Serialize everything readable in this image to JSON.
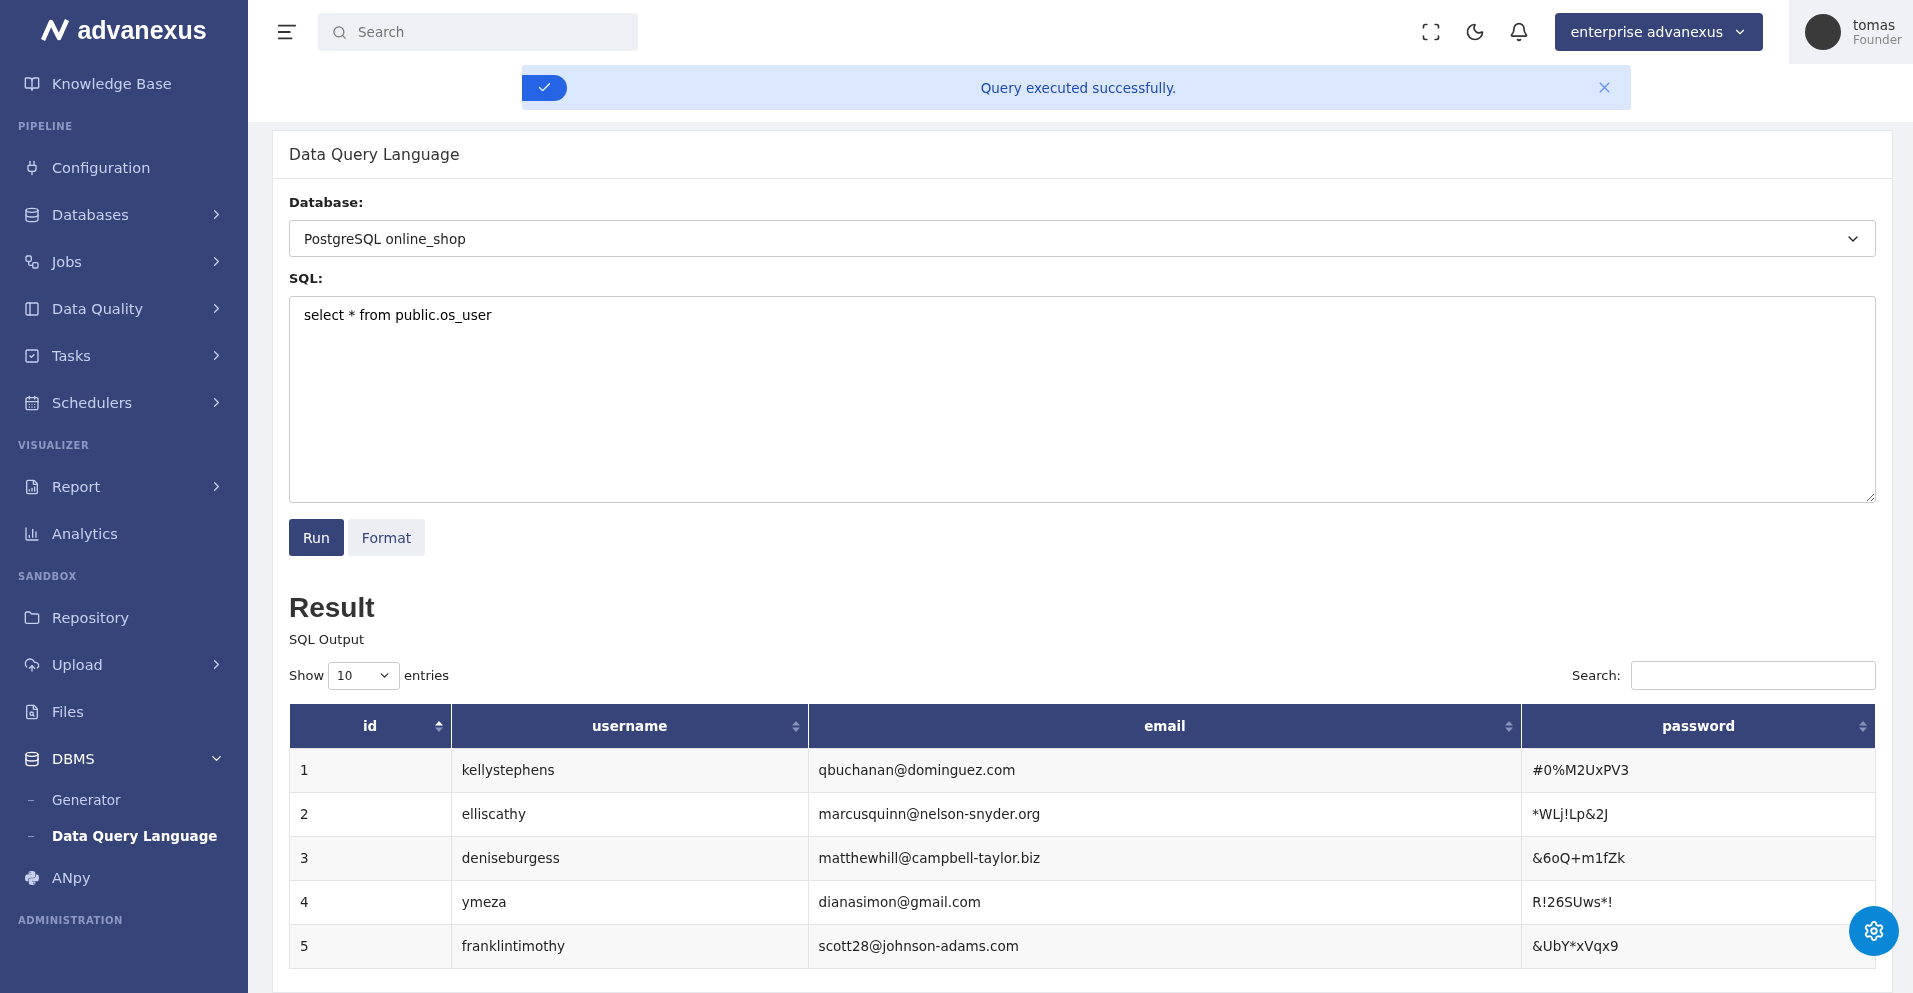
{
  "brand": {
    "name": "advanexus"
  },
  "sidebar": {
    "sections": [
      {
        "items": [
          {
            "label": "Knowledge Base",
            "kind": "link"
          }
        ]
      },
      {
        "label": "PIPELINE",
        "items": [
          {
            "label": "Configuration",
            "kind": "link"
          },
          {
            "label": "Databases",
            "kind": "menu",
            "expanded": false
          },
          {
            "label": "Jobs",
            "kind": "menu",
            "expanded": false
          },
          {
            "label": "Data Quality",
            "kind": "menu",
            "expanded": false
          },
          {
            "label": "Tasks",
            "kind": "menu",
            "expanded": false
          },
          {
            "label": "Schedulers",
            "kind": "menu",
            "expanded": false
          }
        ]
      },
      {
        "label": "VISUALIZER",
        "items": [
          {
            "label": "Report",
            "kind": "menu",
            "expanded": false
          },
          {
            "label": "Analytics",
            "kind": "link"
          }
        ]
      },
      {
        "label": "SANDBOX",
        "items": [
          {
            "label": "Repository",
            "kind": "link"
          },
          {
            "label": "Upload",
            "kind": "menu",
            "expanded": false
          },
          {
            "label": "Files",
            "kind": "link"
          },
          {
            "label": "DBMS",
            "kind": "menu",
            "expanded": true,
            "children": [
              {
                "label": "Generator",
                "selected": false
              },
              {
                "label": "Data Query Language",
                "selected": true
              }
            ]
          },
          {
            "label": "ANpy",
            "kind": "link"
          }
        ]
      },
      {
        "label": "ADMINISTRATION"
      }
    ]
  },
  "topbar": {
    "search": {
      "placeholder": "Search"
    },
    "org_button": "enterprise advanexus",
    "user": {
      "name": "tomas",
      "role": "Founder"
    }
  },
  "alert": {
    "kind": "success",
    "message": "Query executed successfully."
  },
  "card": {
    "title": "Data Query Language",
    "database_label": "Database:",
    "database_value": "PostgreSQL online_shop",
    "sql_label": "SQL:",
    "sql_value": "select * from public.os_user",
    "buttons": [
      {
        "label": "Run",
        "kind": "primary"
      },
      {
        "label": "Format",
        "kind": "secondary"
      }
    ],
    "result": {
      "heading": "Result",
      "subtitle": "SQL Output",
      "show_label": "Show",
      "page_size": "10",
      "entries_label": "entries",
      "search_label": "Search:"
    },
    "table": {
      "columns": [
        {
          "label": "id",
          "sorted_ascending": true
        },
        {
          "label": "username",
          "sorted_ascending": false
        },
        {
          "label": "email",
          "sorted_ascending": false
        },
        {
          "label": "password",
          "sorted_ascending": false
        }
      ],
      "rows": [
        [
          "1",
          "kellystephens",
          "qbuchanan@dominguez.com",
          "#0%M2UxPV3"
        ],
        [
          "2",
          "elliscathy",
          "marcusquinn@nelson-snyder.org",
          "*WLj!Lp&2J"
        ],
        [
          "3",
          "deniseburgess",
          "matthewhill@campbell-taylor.biz",
          "&6oQ+m1fZk"
        ],
        [
          "4",
          "ymeza",
          "dianasimon@gmail.com",
          "R!26SUws*!"
        ],
        [
          "5",
          "franklintimothy",
          "scott28@johnson-adams.com",
          "&UbY*xVqx9"
        ]
      ]
    }
  }
}
